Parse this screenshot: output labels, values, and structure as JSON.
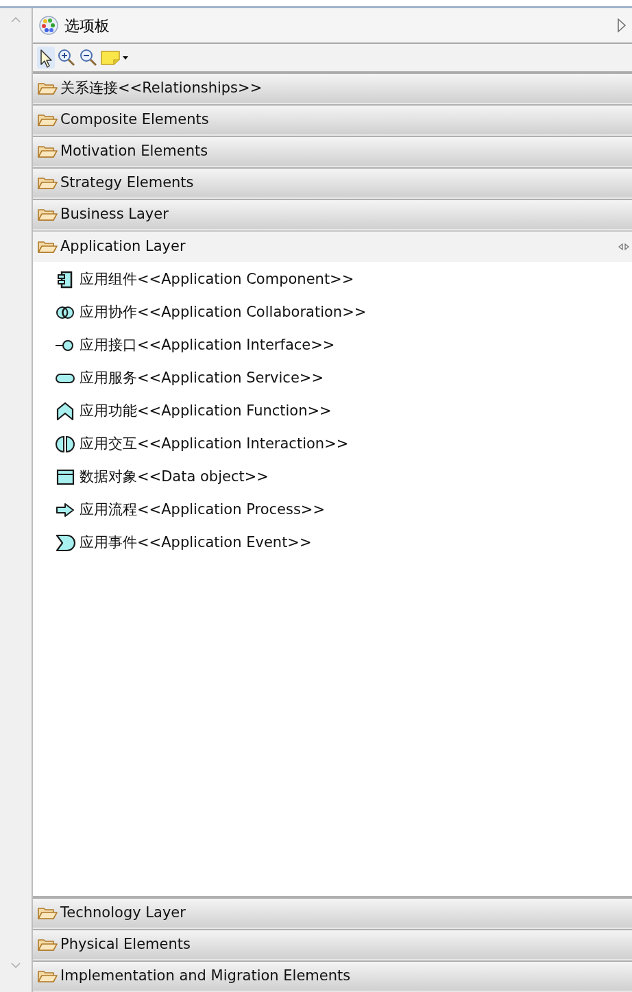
{
  "palette": {
    "title": "选项板"
  },
  "drawers": [
    {
      "label": "关系连接<<Relationships>>",
      "expanded": false
    },
    {
      "label": "Composite Elements",
      "expanded": false
    },
    {
      "label": "Motivation Elements",
      "expanded": false
    },
    {
      "label": "Strategy Elements",
      "expanded": false
    },
    {
      "label": "Business Layer",
      "expanded": false
    },
    {
      "label": "Application Layer",
      "expanded": true,
      "items": [
        {
          "label": "应用组件<<Application Component>>",
          "kind": "component"
        },
        {
          "label": "应用协作<<Application Collaboration>>",
          "kind": "collaboration"
        },
        {
          "label": "应用接口<<Application Interface>>",
          "kind": "interface"
        },
        {
          "label": "应用服务<<Application Service>>",
          "kind": "service"
        },
        {
          "label": "应用功能<<Application Function>>",
          "kind": "function"
        },
        {
          "label": "应用交互<<Application Interaction>>",
          "kind": "interaction"
        },
        {
          "label": "数据对象<<Data object>>",
          "kind": "data"
        },
        {
          "label": "应用流程<<Application Process>>",
          "kind": "process"
        },
        {
          "label": "应用事件<<Application Event>>",
          "kind": "event"
        }
      ]
    },
    {
      "label": "Technology Layer",
      "expanded": false
    },
    {
      "label": "Physical Elements",
      "expanded": false
    },
    {
      "label": "Implementation and Migration Elements",
      "expanded": false
    }
  ]
}
